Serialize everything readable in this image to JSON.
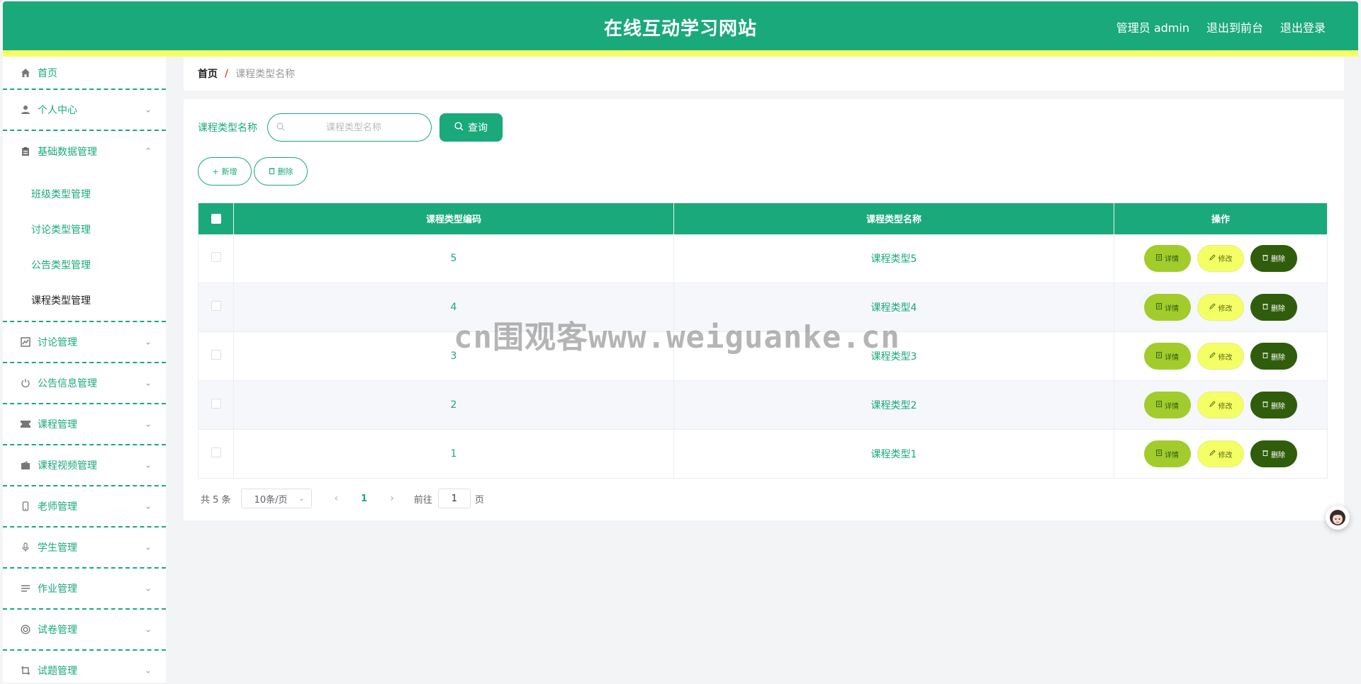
{
  "header": {
    "title": "在线互动学习网站",
    "user": "管理员 admin",
    "to_front": "退出到前台",
    "logout": "退出登录"
  },
  "sidebar": {
    "home": "首页",
    "personal": "个人中心",
    "basic_data": "基础数据管理",
    "sub_items": [
      "班级类型管理",
      "讨论类型管理",
      "公告类型管理",
      "课程类型管理"
    ],
    "discussion": "讨论管理",
    "notice": "公告信息管理",
    "course": "课程管理",
    "course_video": "课程视频管理",
    "teacher": "老师管理",
    "student": "学生管理",
    "homework": "作业管理",
    "exam_paper": "试卷管理",
    "question": "试题管理"
  },
  "breadcrumb": {
    "home": "首页",
    "separator": "/",
    "current": "课程类型名称"
  },
  "search": {
    "label": "课程类型名称",
    "placeholder": "课程类型名称",
    "query_button": "查询"
  },
  "actions": {
    "add": "新增",
    "delete": "删除"
  },
  "table": {
    "headers": [
      "课程类型编码",
      "课程类型名称",
      "操作"
    ],
    "rows": [
      {
        "code": "5",
        "name": "课程类型5"
      },
      {
        "code": "4",
        "name": "课程类型4"
      },
      {
        "code": "3",
        "name": "课程类型3"
      },
      {
        "code": "2",
        "name": "课程类型2"
      },
      {
        "code": "1",
        "name": "课程类型1"
      }
    ],
    "op_detail": "详情",
    "op_edit": "修改",
    "op_delete": "删除"
  },
  "pagination": {
    "total": "共 5 条",
    "page_size": "10条/页",
    "current_page": "1",
    "goto_label": "前往",
    "goto_value": "1",
    "page_unit": "页"
  },
  "watermark": "cn围观客www.weiguanke.cn",
  "colors": {
    "primary": "#1aa97a",
    "stripe": "#f4ff66",
    "detail": "#a2cc2b",
    "edit": "#f4ff66",
    "delete": "#2f5d0c"
  }
}
